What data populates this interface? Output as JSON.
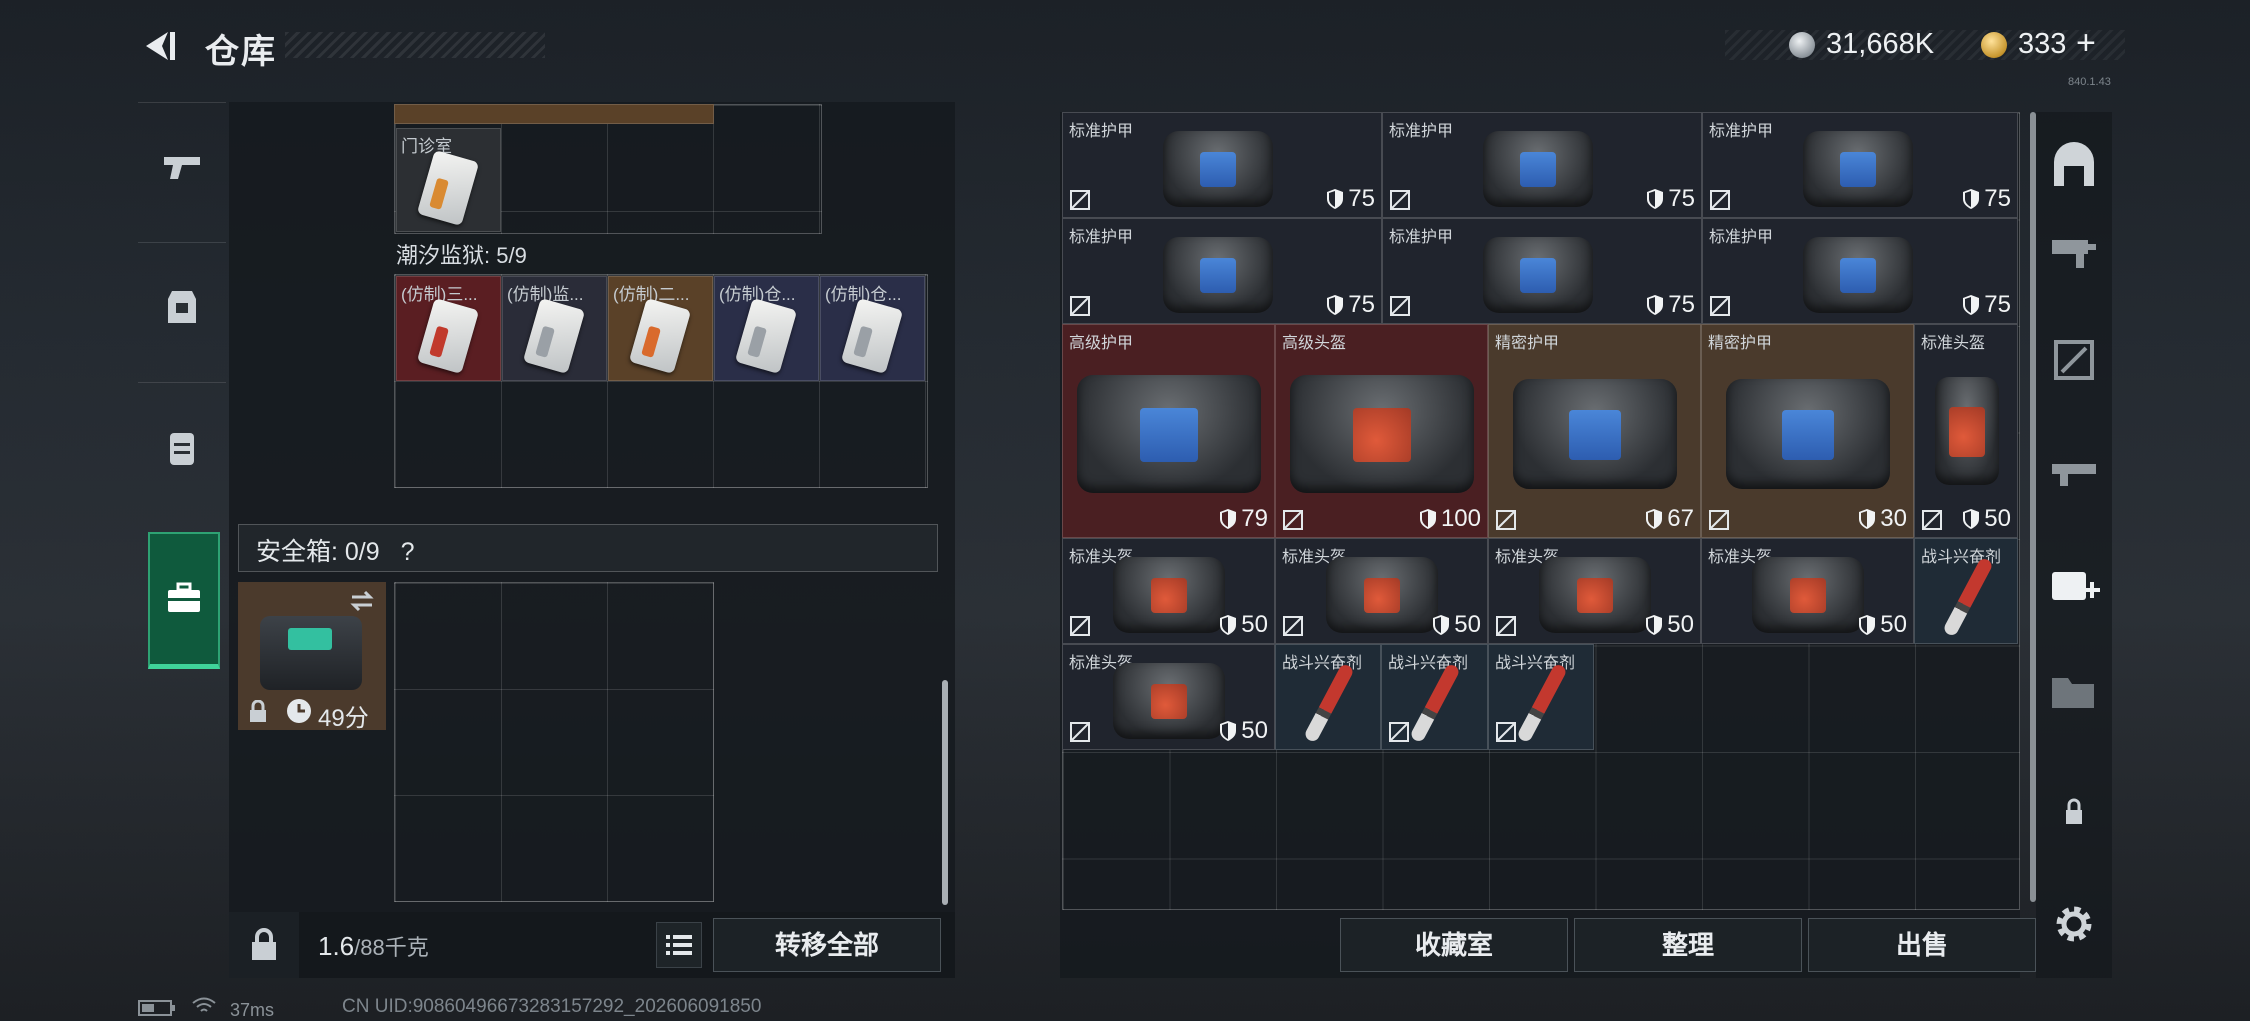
{
  "header": {
    "title": "仓库"
  },
  "currency": {
    "silver": "31,668K",
    "gold": "333",
    "gold_plus": "+"
  },
  "version": "840.1.43",
  "left_nav": {
    "tabs": [
      "weapon",
      "armor",
      "backpack",
      "safebox"
    ],
    "active": "safebox"
  },
  "pouch": {
    "top_item": "门诊室",
    "prison_label": "潮汐监狱: 5/9",
    "keycards": [
      "(仿制)三...",
      "(仿制)监...",
      "(仿制)二...",
      "(仿制)仓...",
      "(仿制)仓..."
    ]
  },
  "safebox": {
    "label": "安全箱: 0/9",
    "help": "?",
    "timer": "49分"
  },
  "footer_left": {
    "weight": "1.6",
    "weight_unit": "/88千克",
    "transfer_label": "转移全部"
  },
  "stash_items": [
    {
      "name": "标准护甲",
      "durability": "75"
    },
    {
      "name": "标准护甲",
      "durability": "75"
    },
    {
      "name": "标准护甲",
      "durability": "75"
    },
    {
      "name": "标准护甲",
      "durability": "75"
    },
    {
      "name": "标准护甲",
      "durability": "75"
    },
    {
      "name": "标准护甲",
      "durability": "75"
    },
    {
      "name": "高级护甲",
      "durability": "79"
    },
    {
      "name": "高级头盔",
      "durability": "100"
    },
    {
      "name": "精密护甲",
      "durability": "67"
    },
    {
      "name": "精密护甲",
      "durability": "30"
    },
    {
      "name": "标准头盔",
      "durability": "50"
    },
    {
      "name": "标准头盔",
      "durability": "50"
    },
    {
      "name": "标准头盔",
      "durability": "50"
    },
    {
      "name": "标准头盔",
      "durability": "50"
    },
    {
      "name": "标准头盔",
      "durability": "50"
    },
    {
      "name": "战斗兴奋剂",
      "durability": ""
    },
    {
      "name": "标准头盔",
      "durability": "50"
    },
    {
      "name": "战斗兴奋剂",
      "durability": ""
    },
    {
      "name": "战斗兴奋剂",
      "durability": ""
    },
    {
      "name": "战斗兴奋剂",
      "durability": ""
    }
  ],
  "actions": {
    "vault": "收藏室",
    "sort": "整理",
    "sell": "出售"
  },
  "status": {
    "ping": "37ms",
    "uid": "CN UID:9086049667328315729​2_202606091850"
  }
}
